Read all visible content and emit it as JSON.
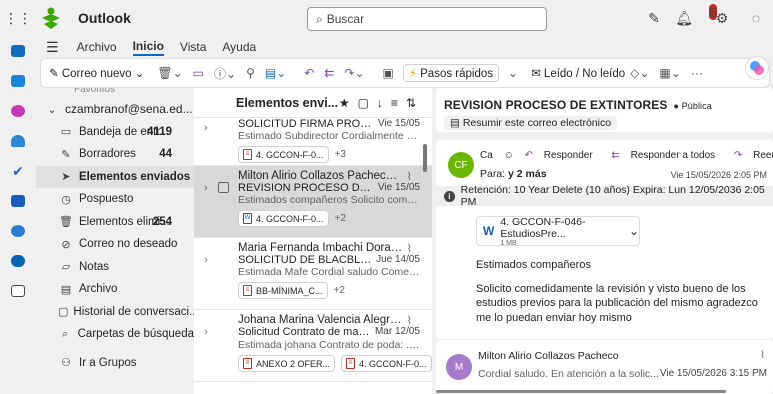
{
  "app": {
    "title": "Outlook",
    "search_placeholder": "Buscar",
    "notification_count": "6"
  },
  "menu": {
    "items": [
      "Archivo",
      "Inicio",
      "Vista",
      "Ayuda"
    ]
  },
  "ribbon": {
    "new_mail": "Correo nuevo",
    "quick_steps": "Pasos rápidos",
    "read_unread": "Leído / No leído"
  },
  "folders": {
    "cut_label": "Favoritos",
    "account": "czambranof@sena.ed...",
    "items": [
      {
        "label": "Bandeja de entr...",
        "count": "4119",
        "icon": "inbox-icon"
      },
      {
        "label": "Borradores",
        "count": "44",
        "icon": "pencil-icon"
      },
      {
        "label": "Elementos enviados",
        "count": "",
        "icon": "send-icon"
      },
      {
        "label": "Pospuesto",
        "count": "",
        "icon": "clock-icon"
      },
      {
        "label": "Elementos elimi...",
        "count": "254",
        "icon": "trash-icon"
      },
      {
        "label": "Correo no deseado",
        "count": "",
        "icon": "junk-icon"
      },
      {
        "label": "Notas",
        "count": "",
        "icon": "note-icon"
      },
      {
        "label": "Archivo",
        "count": "",
        "icon": "archive-icon"
      },
      {
        "label": "Historial de conversaci...",
        "count": "",
        "icon": "history-folder-icon"
      },
      {
        "label": "Carpetas de búsqueda",
        "count": "",
        "icon": "search-folder-icon"
      },
      {
        "label": "Ir a Grupos",
        "count": "",
        "icon": "groups-icon"
      }
    ]
  },
  "list": {
    "title": "Elementos envi...",
    "messages": [
      {
        "from": "",
        "subject": "SOLICITUD FIRMA PROCESO ...",
        "date": "Vie 15/05",
        "preview": "Estimado Subdirector Cordialmente solici...",
        "attachments": [
          "4. GCCON-F-0..."
        ],
        "more": "+3"
      },
      {
        "from": "Milton Alirio Collazos Pacheco; Joha...",
        "subject": "REVISION PROCESO DE EXTIN...",
        "date": "Vie 15/05",
        "preview": "Estimados compañeros Solicito comedid...",
        "attachments": [
          "4. GCCON-F-0..."
        ],
        "more": "+2"
      },
      {
        "from": "Maria Fernanda Imbachi Dorado",
        "subject": "SOLICITUD DE BLACBLOX Y R...",
        "date": "Jue 14/05",
        "preview": "Estimada Mafe Cordial saludo Comedida...",
        "attachments": [
          "BB-MÍNIMA_C..."
        ],
        "more": "+2"
      },
      {
        "from": "Johana Marina Valencia Alegria; Ari...",
        "subject": "Solicitud Contrato de manten...",
        "date": "Mar 12/05",
        "preview": "Estimada johana Contrato de poda: ...",
        "attachments": [
          "ANEXO 2 OFER...",
          "4. GCCON-F-0..."
        ],
        "more": "1"
      }
    ]
  },
  "reading": {
    "subject": "REVISION PROCESO DE EXTINTORES",
    "privacy": "Pública",
    "summarize": "Resumir este correo electrónico",
    "avatar": "CF",
    "avatar_color": "#6bb700",
    "cc": "Ca",
    "to_label": "Para:",
    "to_value": "y 2 más",
    "reply": "Responder",
    "reply_all": "Responder a todos",
    "forward": "Reenviar",
    "date": "Vie 15/05/2026 2:05 PM",
    "retention": "Retención: 10 Year Delete (10 años) Expira: Lun 12/05/2036 2:05 PM",
    "attachment_name": "4. GCCON-F-046-EstudiosPre...",
    "attachment_size": "1 MB",
    "greeting": "Estimados compañeros",
    "body": "Solicito comedidamente la revisión y visto bueno de los estudios previos para la publicación del mismo agradezco me lo puedan enviar hoy mismo"
  },
  "next": {
    "avatar": "M",
    "avatar_color": "#a77bc9",
    "from": "Milton Alirio Collazos Pacheco",
    "preview": "Cordial saludo. En atención a la solic...",
    "date": "Vie 15/05/2026 3:15 PM"
  }
}
